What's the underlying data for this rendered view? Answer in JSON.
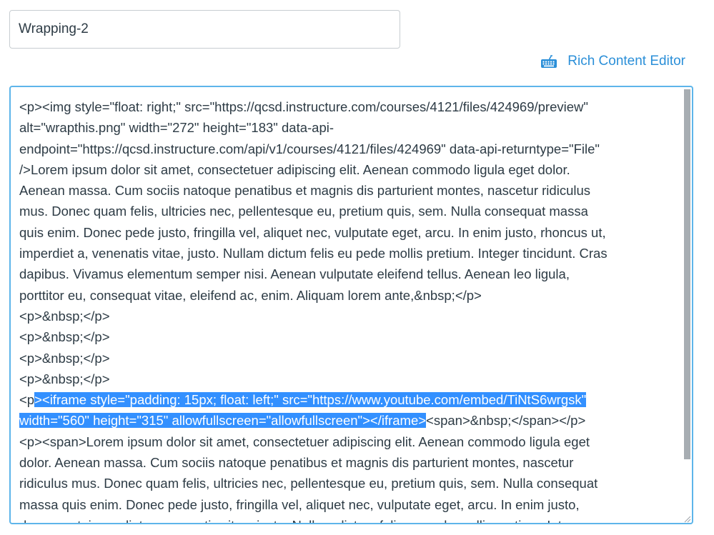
{
  "title_field": {
    "value": "Wrapping-2"
  },
  "editor_toggle": {
    "icon": "keyboard-icon",
    "label": "Rich Content Editor",
    "color": "#2b8fd8"
  },
  "editor": {
    "border_color": "#5db5ea",
    "selection_color": "#3390ff",
    "lines": [
      {
        "pre": "<p><img style=\"float: right;\" src=\"https://qcsd.instructure.com/courses/4121/files/424969/preview\""
      },
      {
        "pre": "alt=\"wrapthis.png\" width=\"272\" height=\"183\" data-api-"
      },
      {
        "pre": "endpoint=\"https://qcsd.instructure.com/api/v1/courses/4121/files/424969\" data-api-returntype=\"File\""
      },
      {
        "pre": "/>Lorem ipsum dolor sit amet, consectetuer adipiscing elit. Aenean commodo ligula eget dolor."
      },
      {
        "pre": "Aenean massa. Cum sociis natoque penatibus et magnis dis parturient montes, nascetur ridiculus"
      },
      {
        "pre": "mus. Donec quam felis, ultricies nec, pellentesque eu, pretium quis, sem. Nulla consequat massa"
      },
      {
        "pre": "quis enim. Donec pede justo, fringilla vel, aliquet nec, vulputate eget, arcu. In enim justo, rhoncus ut,"
      },
      {
        "pre": "imperdiet a, venenatis vitae, justo. Nullam dictum felis eu pede mollis pretium. Integer tincidunt. Cras"
      },
      {
        "pre": "dapibus. Vivamus elementum semper nisi. Aenean vulputate eleifend tellus. Aenean leo ligula,"
      },
      {
        "pre": "porttitor eu, consequat vitae, eleifend ac, enim. Aliquam lorem ante,&nbsp;</p>"
      },
      {
        "pre": "<p>&nbsp;</p>"
      },
      {
        "pre": "<p>&nbsp;</p>"
      },
      {
        "pre": "<p>&nbsp;</p>"
      },
      {
        "pre": "<p>&nbsp;</p>"
      },
      {
        "pre": "<p",
        "selected": "><iframe style=\"padding: 15px; float: left;\" src=\"https://www.youtube.com/embed/TiNtS6wrgsk\"",
        "post": ""
      },
      {
        "pre": "",
        "selected": "width=\"560\" height=\"315\" allowfullscreen=\"allowfullscreen\"></iframe>",
        "post": "<span>&nbsp;</span></p>"
      },
      {
        "pre": "<p><span>Lorem ipsum dolor sit amet, consectetuer adipiscing elit. Aenean commodo ligula eget"
      },
      {
        "pre": "dolor. Aenean massa. Cum sociis natoque penatibus et magnis dis parturient montes, nascetur"
      },
      {
        "pre": "ridiculus mus. Donec quam felis, ultricies nec, pellentesque eu, pretium quis, sem. Nulla consequat"
      },
      {
        "pre": "massa quis enim. Donec pede justo, fringilla vel, aliquet nec, vulputate eget, arcu. In enim justo,"
      },
      {
        "pre": "rhoncus ut, imperdiet a, venenatis vitae, justo. Nullam dictum felis eu pede mollis pretium. Integer"
      }
    ]
  }
}
